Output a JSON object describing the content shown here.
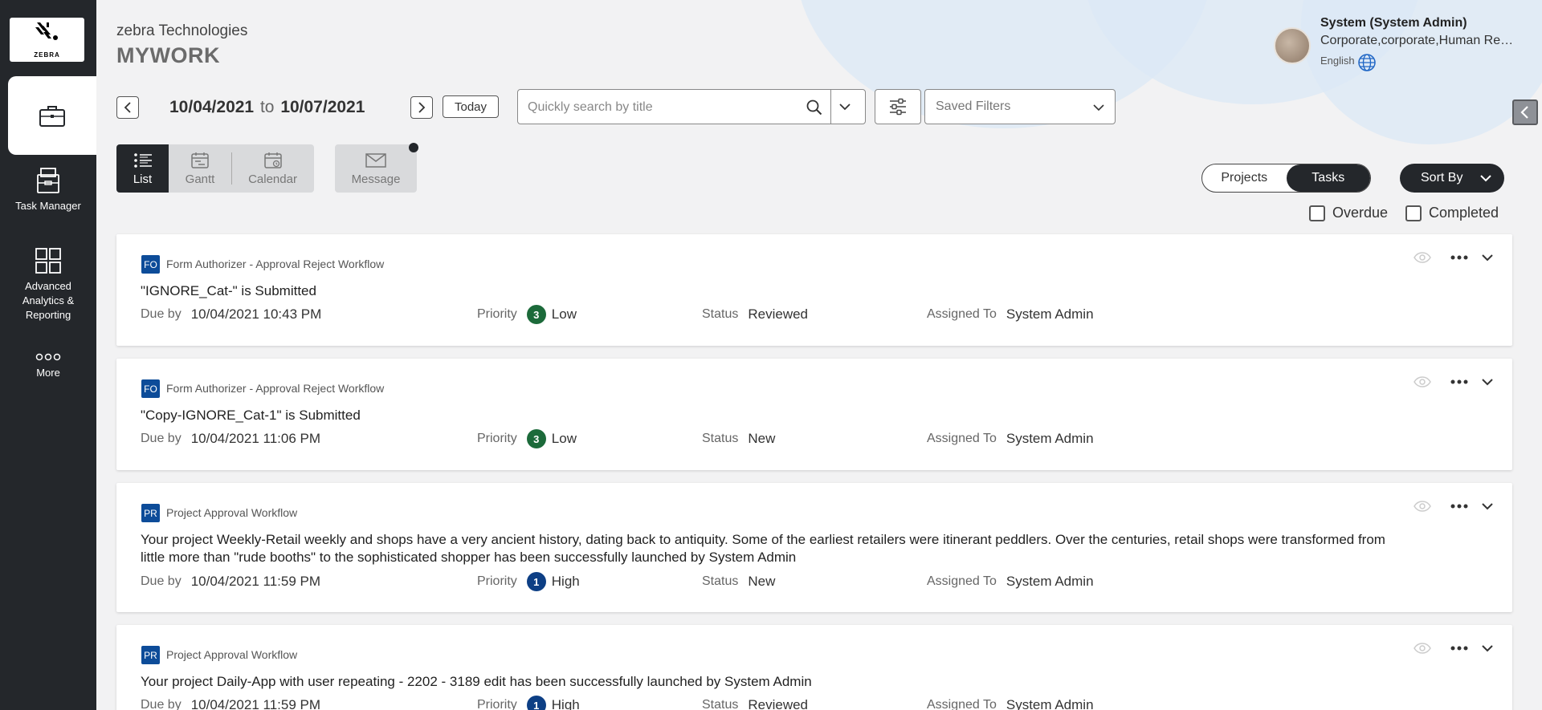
{
  "app": {
    "logo_text": "ZEBRA",
    "company": "zebra Technologies",
    "page_title": "MYWORK"
  },
  "sidebar": {
    "items": [
      {
        "label": "Task Manager",
        "icon": "task-manager-icon"
      },
      {
        "label": "Advanced Analytics & Reporting",
        "icon": "analytics-grid-icon"
      },
      {
        "label": "More",
        "icon": "more-dots-icon"
      }
    ],
    "active_icon": "briefcase-icon"
  },
  "user": {
    "name": "System (System Admin)",
    "org": "Corporate,corporate,Human Resources",
    "language": "English"
  },
  "date_nav": {
    "from": "10/04/2021",
    "to_word": "to",
    "to": "10/07/2021",
    "today_label": "Today"
  },
  "search": {
    "placeholder": "Quickly search by title",
    "saved_filters_label": "Saved Filters"
  },
  "views": {
    "list": "List",
    "gantt": "Gantt",
    "calendar": "Calendar",
    "message": "Message"
  },
  "toggle": {
    "projects": "Projects",
    "tasks": "Tasks",
    "active": "Tasks"
  },
  "sort_label": "Sort By",
  "filters": {
    "overdue": "Overdue",
    "completed": "Completed"
  },
  "labels": {
    "due_by": "Due by",
    "priority": "Priority",
    "status": "Status",
    "assigned_to": "Assigned To"
  },
  "colors": {
    "sidebar": "#24272b",
    "badge": "#0d4c99",
    "priority_low": "#1c6a3a",
    "priority_high": "#0d3f85"
  },
  "tasks": [
    {
      "badge": "FO",
      "workflow": "Form Authorizer - Approval Reject Workflow",
      "title": "\"IGNORE_Cat-\" is Submitted",
      "due": "10/04/2021 10:43 PM",
      "priority_num": "3",
      "priority": "Low",
      "status": "Reviewed",
      "assigned": "System Admin"
    },
    {
      "badge": "FO",
      "workflow": "Form Authorizer - Approval Reject Workflow",
      "title": "\"Copy-IGNORE_Cat-1\" is Submitted",
      "due": "10/04/2021 11:06 PM",
      "priority_num": "3",
      "priority": "Low",
      "status": "New",
      "assigned": "System Admin"
    },
    {
      "badge": "PR",
      "workflow": "Project Approval Workflow",
      "title": "Your project Weekly-Retail weekly and shops have a very ancient history, dating back to antiquity. Some of the earliest retailers were itinerant peddlers. Over the centuries, retail shops were transformed from little more than \"rude booths\" to the sophisticated shopper has been successfully launched by System Admin",
      "due": "10/04/2021 11:59 PM",
      "priority_num": "1",
      "priority": "High",
      "status": "New",
      "assigned": "System Admin"
    },
    {
      "badge": "PR",
      "workflow": "Project Approval Workflow",
      "title": "Your project Daily-App with user repeating - 2202 - 3189 edit has been successfully launched by System Admin",
      "due": "10/04/2021 11:59 PM",
      "priority_num": "1",
      "priority": "High",
      "status": "Reviewed",
      "assigned": "System Admin"
    }
  ]
}
